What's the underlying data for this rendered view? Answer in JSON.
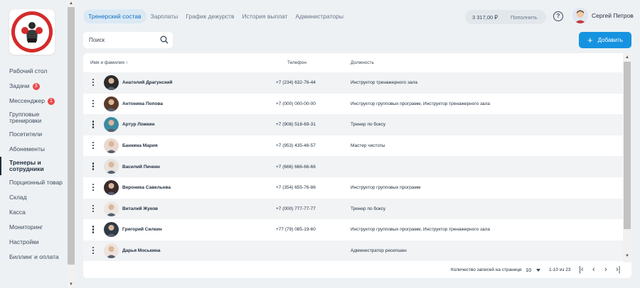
{
  "nav": [
    {
      "label": "Рабочий стол",
      "badge": ""
    },
    {
      "label": "Задачи",
      "badge": "3"
    },
    {
      "label": "Мессенджер",
      "badge": "1"
    },
    {
      "label": "Групповые тренировки",
      "badge": ""
    },
    {
      "label": "Посетители",
      "badge": ""
    },
    {
      "label": "Абонементы",
      "badge": ""
    },
    {
      "label": "Тренеры и сотрудники",
      "badge": "",
      "active": true
    },
    {
      "label": "Порционный товар",
      "badge": ""
    },
    {
      "label": "Склад",
      "badge": ""
    },
    {
      "label": "Касса",
      "badge": ""
    },
    {
      "label": "Мониторинг",
      "badge": ""
    },
    {
      "label": "Настройки",
      "badge": ""
    },
    {
      "label": "Биллинг и оплата",
      "badge": ""
    }
  ],
  "tabs": [
    "Тренерский состав",
    "Зарплаты",
    "График дежурств",
    "История выплат",
    "Администраторы"
  ],
  "balance": {
    "amount": "3 317,00 ₽",
    "topup": "Пополнить"
  },
  "help_label": "?",
  "user": {
    "name": "Сергей Петров"
  },
  "search": {
    "placeholder": "Поиск"
  },
  "add_button": {
    "label": "Добавить"
  },
  "table": {
    "headers": {
      "name": "Имя и фамилия",
      "sort_arrow": "↑",
      "phone": "Телефон",
      "position": "Должность"
    },
    "rows": [
      {
        "name": "Анатолий Драгунский",
        "phone": "+7 (234) 632-76-44",
        "position": "Инструктор тренажерного зала",
        "avatar": "#2b2b2b"
      },
      {
        "name": "Антонина Попова",
        "phone": "+7 (000) 000-00-00",
        "position": "Инструктор групповых программ, Инструктор тренажерного зала",
        "avatar": "#5a3a2a"
      },
      {
        "name": "Артур Ложкин",
        "phone": "+7 (908) 518-69-31",
        "position": "Тренер по боксу",
        "avatar": "#3d8aa0"
      },
      {
        "name": "Банкина Мария",
        "phone": "+7 (953) 435-46-57",
        "position": "Мастер чистоты",
        "avatar": "#e9d9cf"
      },
      {
        "name": "Василий Печкин",
        "phone": "+7 (666) 666-66-66",
        "position": "",
        "avatar": "#e7e2de"
      },
      {
        "name": "Вероника Савельева",
        "phone": "+7 (354) 655-76-86",
        "position": "Инструктор групповых программ",
        "avatar": "#3a2a2a"
      },
      {
        "name": "Виталий Жуков",
        "phone": "+7 (000) 777-77-77",
        "position": "Тренер по боксу",
        "avatar": "#ece6e0"
      },
      {
        "name": "Григорий Силкин",
        "phone": "+77 (79) 085-19-60",
        "position": "Инструктор групповых программ, Инструктор тренажерного зала",
        "avatar": "#2f3a44"
      },
      {
        "name": "Дарья Моськина",
        "phone": "",
        "position": "Администратор ресепшен",
        "avatar": "#efe2dc"
      }
    ]
  },
  "pager": {
    "label": "Количество записей на странице",
    "per_page": "10",
    "range": "1-10 из 23",
    "first": "|‹",
    "prev": "‹",
    "next": "›",
    "last": "›|"
  }
}
